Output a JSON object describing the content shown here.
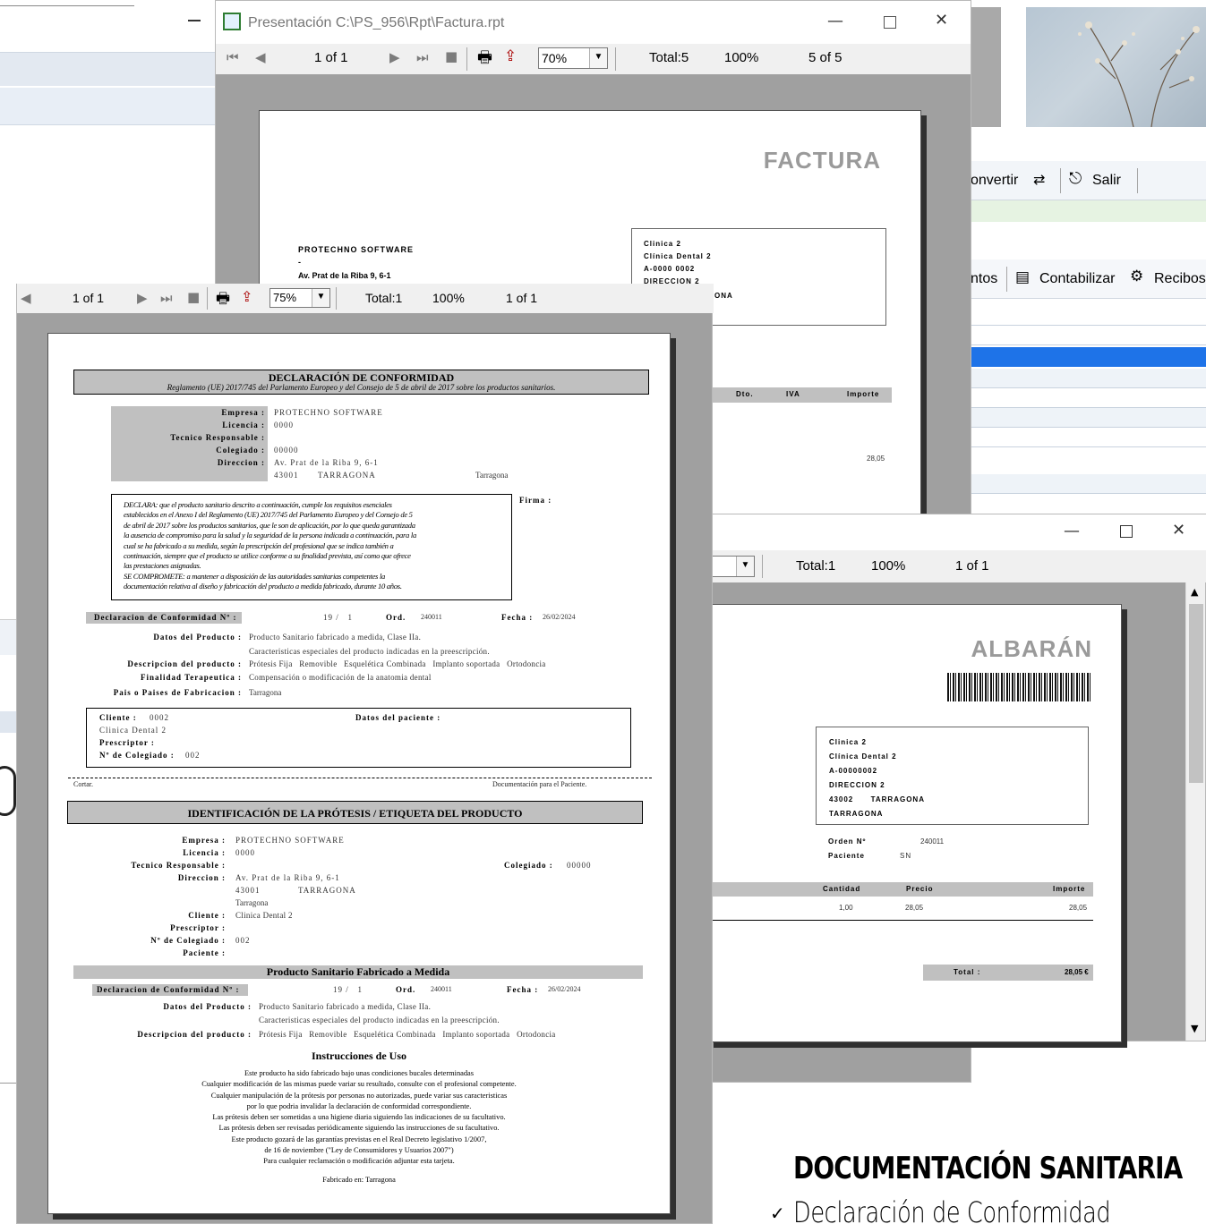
{
  "factura_window": {
    "title": "Presentación C:\\PS_956\\Rpt\\Factura.rpt",
    "toolbar": {
      "page": "1 of 1",
      "zoom": "70%",
      "total": "Total:5",
      "percent": "100%",
      "count": "5 of 5"
    },
    "doc": {
      "heading": "FACTURA",
      "company": "PROTECHNO SOFTWARE",
      "dash": "-",
      "address": "Av. Prat de la Riba 9, 6-1",
      "client_lines": [
        "Clinica 2",
        "Clínica Dental 2",
        "A-0000 0002",
        "DIRECCION 2",
        "AGONA"
      ],
      "col_headers": [
        "Dto.",
        "IVA",
        "Importe"
      ],
      "amount": "28,05"
    }
  },
  "background_app": {
    "menu1": [
      "onvertir",
      "Salir"
    ],
    "menu2": [
      "ntos",
      "Contabilizar",
      "Recibos"
    ]
  },
  "declaracion_window": {
    "toolbar": {
      "page": "1 of 1",
      "zoom": "75%",
      "total": "Total:1",
      "percent": "100%",
      "count": "1 of 1"
    },
    "doc": {
      "title": "DECLARACIÓN DE CONFORMIDAD",
      "subtitle": "Reglamento (UE) 2017/745 del Parlamento Europeo y del Consejo de 5 de abril de 2017 sobre los productos sanitarios.",
      "fields": [
        {
          "label": "Empresa :",
          "value": "PROTECHNO SOFTWARE"
        },
        {
          "label": "Licencia :",
          "value": "0000"
        },
        {
          "label": "Tecnico Responsable :",
          "value": ""
        },
        {
          "label": "Colegiado :",
          "value": "00000"
        },
        {
          "label": "Direccion :",
          "value": "Av. Prat de la Riba 9, 6-1"
        }
      ],
      "postal": "43001",
      "city": "TARRAGONA",
      "province": "Tarragona",
      "firma": "Firma :",
      "declara_lines": [
        "DECLARA: que el producto sanitario descrito a continuación, cumple los requisitos esenciales",
        "establecidos en el Anexo I del Reglamento (UE) 2017/745 del Parlamento Europeo y del Consejo de 5",
        "de abril de 2017 sobre los productos sanitarios, que le son de aplicación, por lo que queda garantizada",
        "la ausencia de compromiso para la salud y la seguridad de la persona indicada a continuación, para la",
        "cual se ha fabricado a su medida, según la prescripción del profesional que se indica también a",
        "continuación, siempre que el producto se utilice conforme a su finalidad prevista, así como que ofrece",
        "las prestaciones asignadas.",
        "SE COMPROMETE: a mantener a disposición de las autoridades sanitarias competentes la",
        "documentación relativa al diseño y fabricación del producto a medida fabricado, durante 10 años."
      ],
      "decl_num_label": "Declaracion de Conformidad Nº :",
      "decl_num": "19 /   1",
      "ord_label": "Ord.",
      "ord": "240011",
      "fecha_label": "Fecha :",
      "fecha": "26/02/2024",
      "datos_producto_label": "Datos del Producto :",
      "datos_producto": "Producto Sanitario fabricado a medida, Clase IIa.",
      "caracteristicas": "Caracteristicas especiales del producto indicadas en la preescripción.",
      "descripcion_label": "Descripcion del producto :",
      "descripcion": "Prótesis Fija   Removible   Esquelética Combinada   Implanto soportada   Ortodoncia",
      "finalidad_label": "Finalidad Terapeutica :",
      "finalidad": "Compensación o modificación de la anatomia dental",
      "pais_label": "Pais o Paises de Fabricacion :",
      "pais": "Tarragona",
      "cliente_label": "Cliente :",
      "cliente_code": "0002",
      "cliente_name": "Clinica Dental 2",
      "prescriptor_label": "Prescriptor :",
      "colegiado_label": "Nº de Colegiado :",
      "colegiado": "002",
      "paciente_label": "Datos del paciente :",
      "cortar": "Cortar.",
      "doc_paciente": "Documentación para el Paciente.",
      "ident_title": "IDENTIFICACIÓN DE LA PRÓTESIS / ETIQUETA DEL PRODUCTO",
      "ident_fields": [
        {
          "label": "Empresa :",
          "value": "PROTECHNO SOFTWARE"
        },
        {
          "label": "Licencia :",
          "value": "0000"
        },
        {
          "label": "Tecnico Responsable :",
          "value": ""
        },
        {
          "label": "Direccion :",
          "value": "Av. Prat de la Riba 9, 6-1"
        }
      ],
      "ident_colegiado_label": "Colegiado :",
      "ident_colegiado": "00000",
      "ident_cliente_label": "Cliente :",
      "ident_prescriptor_label": "Prescriptor :",
      "ident_numcol_label": "Nº de Colegiado :",
      "ident_paciente_label": "Paciente :",
      "producto_title": "Producto Sanitario Fabricado a Medida",
      "instrucciones_title": "Instrucciones de Uso",
      "instrucciones": [
        "Este producto ha sido fabricado bajo unas condiciones bucales determinadas",
        "Cualquier modificación de las mismas puede variar su resultado, consulte con el profesional competente.",
        "Cualquier manipulación de la prótesis por personas no autorizadas, puede variar sus caracteristicas",
        "por lo que podria invalidar la declaración de conformidad correspondiente.",
        "Las prótesis deben ser sometidas a una higiene diaria siguiendo las indicaciones de su facultativo.",
        "Las prótesis deben ser revisadas periódicamente siguiendo las instrucciones de su facultativo.",
        "Este producto gozará de las garantías previstas en el Real Decreto legislativo 1/2007,",
        "de 16 de noviembre (\"Ley de Consumidores y Usuarios 2007\")",
        "Para cualquier reclamación o modificación adjuntar esta tarjeta."
      ],
      "fabricado": "Fabricado en: Tarragona"
    }
  },
  "albaran_window": {
    "toolbar": {
      "total": "Total:1",
      "percent": "100%",
      "count": "1 of 1"
    },
    "doc": {
      "heading": "ALBARÁN",
      "client_lines": [
        "Clinica 2",
        "Clínica Dental 2",
        "A-00000002",
        "DIRECCION 2",
        "43002      TARRAGONA",
        "TARRAGONA"
      ],
      "orden_label": "Orden Nº",
      "orden": "240011",
      "paciente_label": "Paciente",
      "paciente": "SN",
      "col_headers": [
        "Cantidad",
        "Precio",
        "Importe"
      ],
      "row": [
        "1,00",
        "28,05",
        "28,05"
      ],
      "total_label": "Total :",
      "total": "28,05 €"
    }
  },
  "promo": {
    "heading": "DOCUMENTACIÓN SANITARIA",
    "item": "Declaración de Conformidad"
  },
  "colors": {
    "accent_blue": "#1e73e8",
    "viewer_gray": "#a0a0a0",
    "bar_gray": "#c0c0c0"
  }
}
